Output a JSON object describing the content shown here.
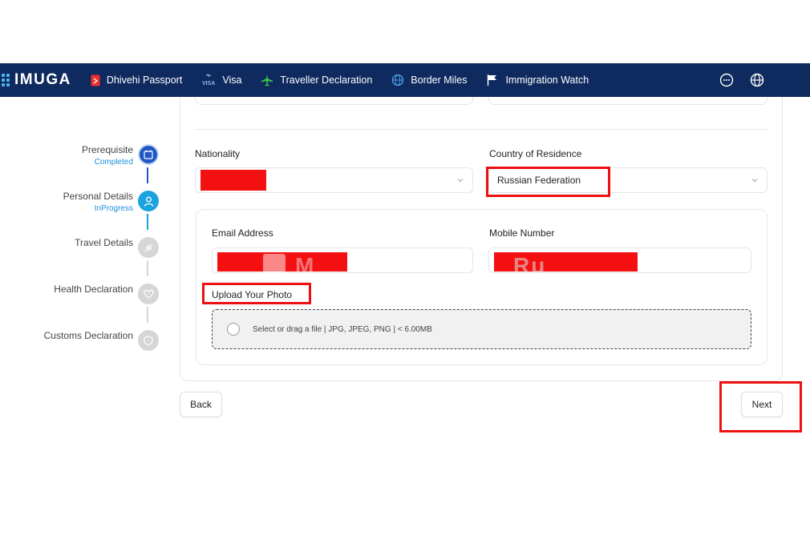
{
  "nav": {
    "logo": "IMUGA",
    "items": [
      {
        "label": "Dhivehi Passport",
        "icon": "passport-icon"
      },
      {
        "label": "Visa",
        "icon": "visa-icon"
      },
      {
        "label": "Traveller Declaration",
        "icon": "airplane-icon"
      },
      {
        "label": "Border Miles",
        "icon": "globe-icon"
      },
      {
        "label": "Immigration Watch",
        "icon": "flag-icon"
      }
    ],
    "right_icons": [
      "chat-icon",
      "language-globe-icon"
    ],
    "colors": {
      "background": "#0f2a5f",
      "logo_accent": "#4fb6f0"
    }
  },
  "stepper": {
    "steps": [
      {
        "label": "Prerequisite",
        "status": "Completed",
        "state": "completed",
        "icon": "calendar-check-icon"
      },
      {
        "label": "Personal Details",
        "status": "InProgress",
        "state": "in-progress",
        "icon": "user-icon"
      },
      {
        "label": "Travel Details",
        "status": "",
        "state": "pending",
        "icon": "plane-slash-icon"
      },
      {
        "label": "Health Declaration",
        "status": "",
        "state": "pending",
        "icon": "heart-icon"
      },
      {
        "label": "Customs Declaration",
        "status": "",
        "state": "pending",
        "icon": "shield-icon"
      }
    ],
    "colors": {
      "completed": "#1f57c3",
      "in_progress": "#1ba3e0",
      "pending": "#d6d6d6",
      "status_text": "#1a8fd8"
    }
  },
  "form": {
    "nationality": {
      "label": "Nationality",
      "value": "",
      "redacted": true
    },
    "country_of_residence": {
      "label": "Country of Residence",
      "value": "Russian Federation"
    },
    "email": {
      "label": "Email Address",
      "value": "",
      "redacted": true
    },
    "mobile": {
      "label": "Mobile Number",
      "value": "",
      "redacted": true
    },
    "photo": {
      "label": "Upload Your Photo",
      "hint": "Select or drag a file | JPG, JPEG, PNG | < 6.00MB"
    }
  },
  "actions": {
    "back": "Back",
    "next": "Next"
  },
  "annotation_color": "#ee0f12"
}
